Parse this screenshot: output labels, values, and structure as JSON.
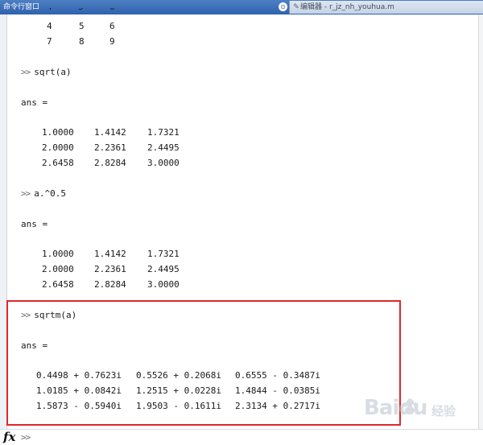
{
  "titlebar": {
    "title": "命令行窗口",
    "menu_icon": "⊙",
    "editor_tab": "编辑器 - r_jz_nh_youhua.m"
  },
  "console": {
    "prompt": ">>",
    "top_partial_row": [
      "4",
      "5",
      "6"
    ],
    "top_rows": [
      [
        "4",
        "5",
        "6"
      ],
      [
        "7",
        "8",
        "9"
      ]
    ],
    "blocks": [
      {
        "command": "sqrt(a)",
        "ans_label": "ans =",
        "rows": [
          [
            "1.0000",
            "1.4142",
            "1.7321"
          ],
          [
            "2.0000",
            "2.2361",
            "2.4495"
          ],
          [
            "2.6458",
            "2.8284",
            "3.0000"
          ]
        ]
      },
      {
        "command": "a.^0.5",
        "ans_label": "ans =",
        "rows": [
          [
            "1.0000",
            "1.4142",
            "1.7321"
          ],
          [
            "2.0000",
            "2.2361",
            "2.4495"
          ],
          [
            "2.6458",
            "2.8284",
            "3.0000"
          ]
        ]
      },
      {
        "command": "sqrtm(a)",
        "ans_label": "ans =",
        "rows": [
          [
            "0.4498 + 0.7623i",
            "0.5526 + 0.2068i",
            "0.6555 - 0.3487i"
          ],
          [
            "1.0185 + 0.0842i",
            "1.2515 + 0.0228i",
            "1.4844 - 0.0385i"
          ],
          [
            "1.5873 - 0.5940i",
            "1.9503 - 0.1611i",
            "2.3134 + 0.2717i"
          ]
        ]
      }
    ]
  },
  "command_line": {
    "fx_label": "fx",
    "prompt": ">>",
    "value": ""
  },
  "highlight_color": "#e0262a",
  "watermark": {
    "brand": "Baidu",
    "sub": "经验"
  }
}
